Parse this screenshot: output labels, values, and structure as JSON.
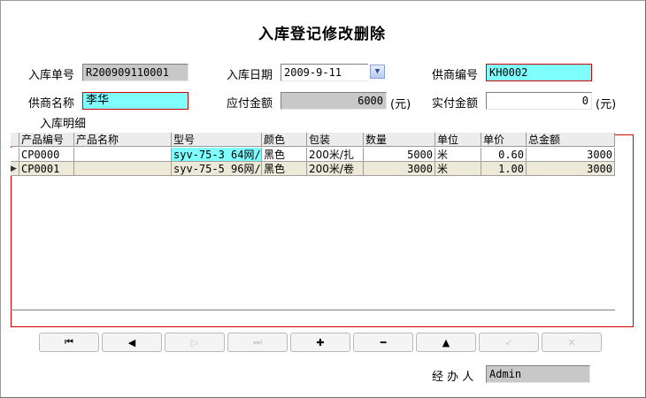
{
  "title": "入库登记修改删除",
  "form": {
    "order_no_label": "入库单号",
    "order_no_value": "R200909110001",
    "date_label": "入库日期",
    "date_value": "2009-9-11",
    "supplier_code_label": "供商编号",
    "supplier_code_value": "KH0002",
    "supplier_name_label": "供商名称",
    "supplier_name_value": "李华",
    "payable_label": "应付金额",
    "payable_value": "6000",
    "payable_unit": "(元)",
    "paid_label": "实付金额",
    "paid_value": "0",
    "paid_unit": "(元)",
    "detail_label": "入库明细"
  },
  "grid": {
    "columns": [
      "产品编号",
      "产品名称",
      "型号",
      "颜色",
      "包装",
      "数量",
      "单位",
      "单价",
      "总金额"
    ],
    "rows": [
      {
        "code": "CP0000",
        "name": "",
        "model": "syv-75-3 64网/",
        "color": "黑色",
        "pack": "200米/扎",
        "qty": "5000",
        "unit": "米",
        "price": "0.60",
        "total": "3000"
      },
      {
        "code": "CP0001",
        "name": "",
        "model": "syv-75-5 96网/",
        "color": "黑色",
        "pack": "200米/卷",
        "qty": "3000",
        "unit": "米",
        "price": "1.00",
        "total": "3000"
      }
    ]
  },
  "nav": {
    "first": "⏮",
    "prev": "◀",
    "next": "▷",
    "last": "⏭",
    "add": "✚",
    "delete": "━",
    "edit": "▲",
    "post": "✓",
    "cancel": "✕"
  },
  "operator": {
    "label": "经 办 人",
    "value": "Admin"
  }
}
